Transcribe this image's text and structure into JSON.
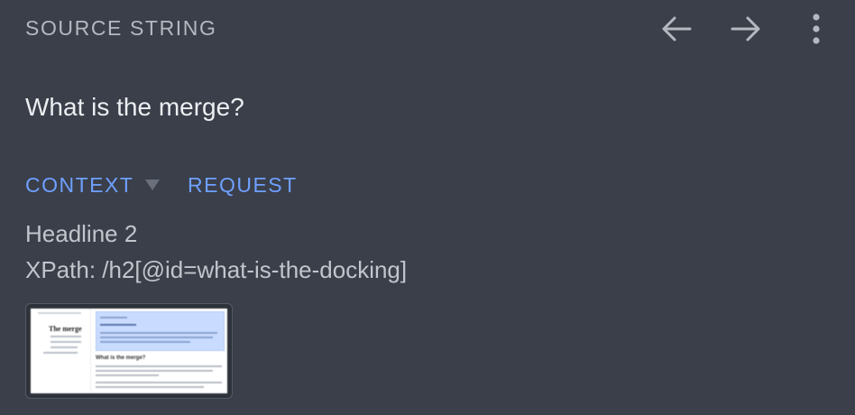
{
  "header": {
    "title": "SOURCE STRING",
    "icons": [
      "arrow-left-icon",
      "arrow-right-icon",
      "more-vert-icon"
    ]
  },
  "source": {
    "text": "What is the merge?"
  },
  "tabs": [
    {
      "label": "CONTEXT",
      "has_dropdown": true
    },
    {
      "label": "REQUEST"
    }
  ],
  "context": {
    "element_type": "Headline 2",
    "xpath": "XPath: /h2[@id=what-is-the-docking]"
  },
  "screenshot_thumb": {
    "title": "The merge",
    "section_heading": "What is the merge?"
  },
  "colors": {
    "background": "#3a3f4a",
    "accent": "#6fa0ff",
    "muted_text": "#b4b8bf"
  }
}
